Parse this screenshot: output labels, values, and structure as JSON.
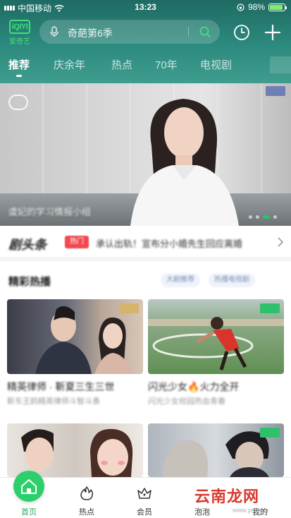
{
  "status_bar": {
    "carrier": "中国移动",
    "time": "13:23",
    "battery": "98%",
    "battery_level": 0.98
  },
  "header": {
    "logo_mark": "iQIYI",
    "logo_text": "爱奇艺",
    "search_placeholder": "奇葩第6季",
    "icons": [
      "mic-icon",
      "search-icon",
      "history-icon",
      "plus-icon"
    ]
  },
  "tabs": [
    {
      "label": "推荐",
      "active": true
    },
    {
      "label": "庆余年",
      "active": false
    },
    {
      "label": "热点",
      "active": false
    },
    {
      "label": "70年",
      "active": false
    },
    {
      "label": "电视剧",
      "active": false
    }
  ],
  "banner": {
    "caption": "虞妃的学习情报小组"
  },
  "ticker": {
    "brand": "剧头条",
    "tag": "热门",
    "headline": "承认出轨！宣布分小婚先生回应离婚"
  },
  "section": {
    "title": "精彩热播",
    "chips": [
      "大剧推荐",
      "热播电视剧"
    ]
  },
  "cards": [
    {
      "title": "精英律师 · 靳夏三生三世",
      "sub": "靳东王鸥精英律师斗智斗勇",
      "badge": "vip"
    },
    {
      "title": "闪光少女🔥火力全开",
      "sub": "闪光少女校园热血青春",
      "badge": "green"
    },
    {
      "title": "",
      "sub": "",
      "badge": "none"
    },
    {
      "title": "",
      "sub": "",
      "badge": "green"
    }
  ],
  "bottom_nav": [
    {
      "label": "首页",
      "icon": "home-icon",
      "active": true
    },
    {
      "label": "热点",
      "icon": "flame-icon",
      "active": false
    },
    {
      "label": "会员",
      "icon": "crown-icon",
      "active": false
    },
    {
      "label": "泡泡",
      "icon": "bubble-icon",
      "active": false
    },
    {
      "label": "我的",
      "icon": "profile-icon",
      "active": false
    }
  ],
  "watermark": {
    "text": "云南龙网",
    "url": "www.ynlw.cn"
  },
  "colors": {
    "brand_green": "#2ccf6b",
    "header_teal": "#2d8a7e",
    "tag_red": "#f0494f"
  }
}
